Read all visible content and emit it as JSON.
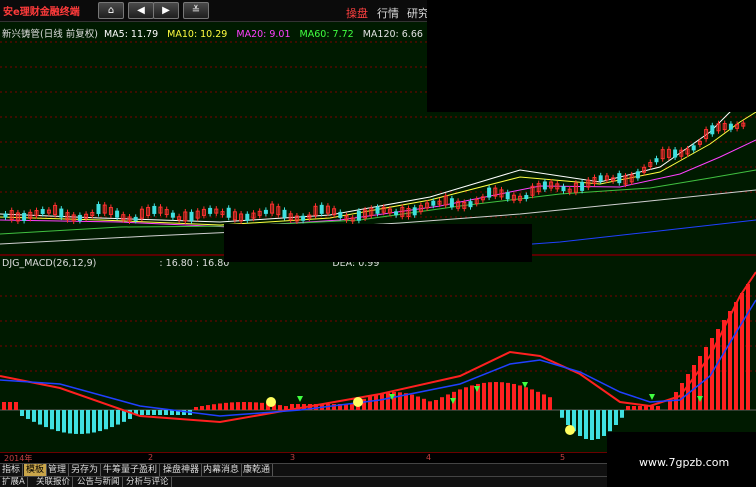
{
  "app": {
    "logo": "安e理财金融终端"
  },
  "toolbar": {
    "buttons": [
      {
        "name": "home-button",
        "icon": "⌂"
      },
      {
        "name": "back-button",
        "icon": "◀"
      },
      {
        "name": "forward-button",
        "icon": "▶"
      },
      {
        "name": "collapse-button",
        "icon": "≚"
      }
    ],
    "menu": [
      "操盘",
      "行情",
      "研究"
    ]
  },
  "kline": {
    "title": "新兴铸管(日线 前复权)",
    "ma": [
      {
        "label": "MA5:",
        "value": "11.79",
        "color": "#ffffff"
      },
      {
        "label": "MA10:",
        "value": "10.29",
        "color": "#ffff00"
      },
      {
        "label": "MA20:",
        "value": "9.01",
        "color": "#ff40ff"
      },
      {
        "label": "MA60:",
        "value": "7.72",
        "color": "#40ff40"
      },
      {
        "label": "MA120:",
        "value": "6.66",
        "color": "#e0e0e0"
      }
    ]
  },
  "macd": {
    "title": "DJG_MACD(26,12,9)",
    "values": [
      "16.80",
      "16.80"
    ],
    "dea_label": "DEA: 0.99"
  },
  "dateaxis": [
    "2014年",
    "2",
    "3",
    "4",
    "5"
  ],
  "tabs_row1": [
    "指标",
    "模板",
    "管理",
    "另存为",
    "牛筹量子盈利",
    "操盘神器",
    "内幕消息",
    "康乾通"
  ],
  "tabs_row2": [
    "扩展A",
    "关联报价",
    "公告与新闻",
    "分析与评论"
  ],
  "watermark": "www.7gpzb.com",
  "colors": {
    "up": "#ff2020",
    "down": "#40e0e0",
    "dif": "#ff2020",
    "dea": "#2040ff"
  }
}
